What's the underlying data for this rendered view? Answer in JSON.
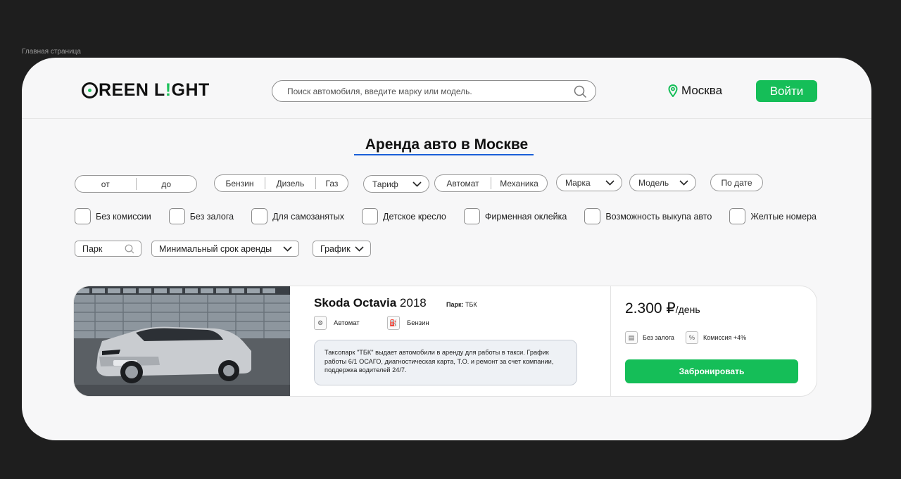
{
  "frame_label": "Главная страница",
  "header": {
    "logo_text_1": "REEN L",
    "logo_text_dot": "!",
    "logo_text_2": "GHT",
    "search_placeholder": "Поиск автомобиля, введите марку или модель.",
    "city": "Москва",
    "login_label": "Войти"
  },
  "page_title": "Аренда авто в Москве",
  "filters": {
    "price_from": "от",
    "price_to": "до",
    "fuel": [
      "Бензин",
      "Дизель",
      "Газ"
    ],
    "tariff": "Тариф",
    "transmission": [
      "Автомат",
      "Механика"
    ],
    "brand": "Марка",
    "model": "Модель",
    "by_date": "По дате",
    "checkboxes": [
      "Без комиссии",
      "Без залога",
      "Для самозанятых",
      "Детское кресло",
      "Фирменная оклейка",
      "Возможность выкупа авто",
      "Желтые номера"
    ],
    "park_placeholder": "Парк",
    "min_term": "Минимальный срок аренды",
    "schedule": "График"
  },
  "listing": {
    "car_model": "Skoda Octavia",
    "car_year": "2018",
    "park_label": "Парк:",
    "park_value": "ТБК",
    "transmission": "Автомат",
    "fuel": "Бензин",
    "description": "Таксопарк \"ТБК\" выдает автомобили в аренду для работы в такси. График работы 6/1 ОСАГО, диагностическая карта, Т.О. и ремонт за счет компании, поддержка водителей 24/7.",
    "price": "2.300 ₽",
    "price_unit": "/день",
    "no_deposit": "Без залога",
    "commission": "Комиссия +4%",
    "book_label": "Забронировать"
  },
  "colors": {
    "accent": "#15be58",
    "title_underline": "#1a5fd8",
    "background": "#1e1e1e"
  }
}
